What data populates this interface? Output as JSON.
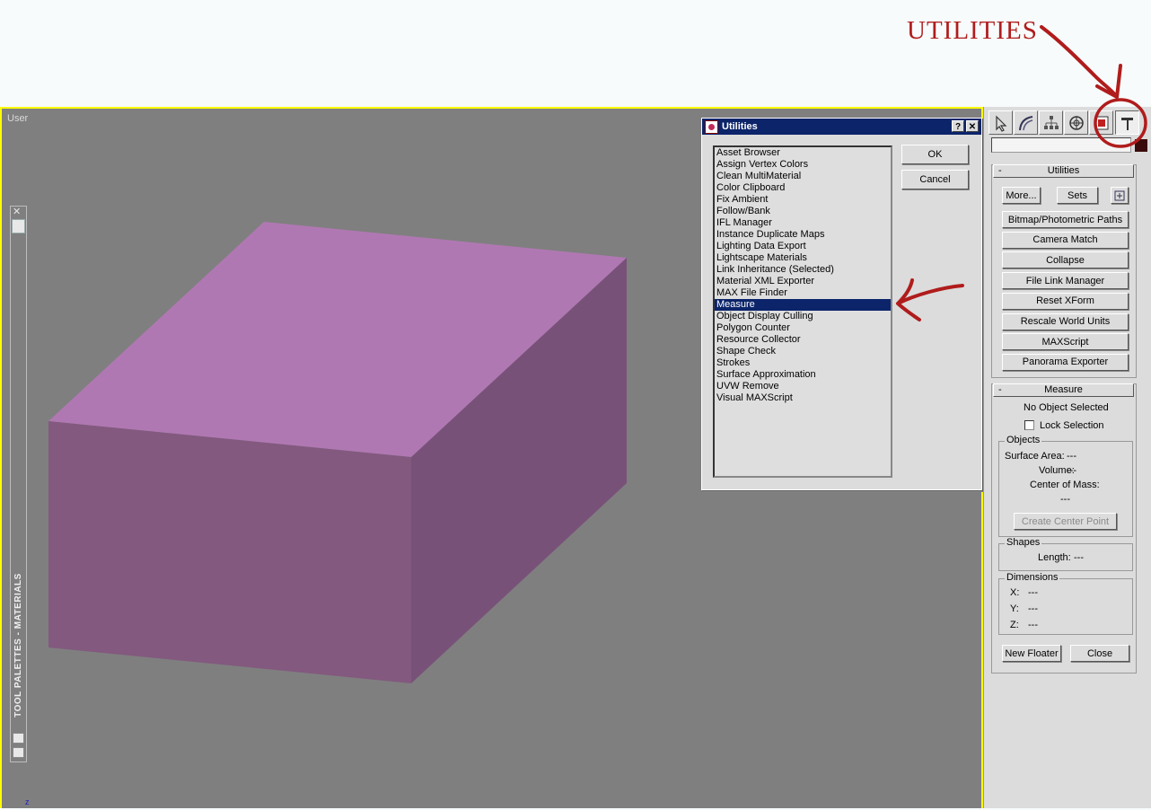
{
  "annotation": {
    "title": "UTILITIES"
  },
  "viewport": {
    "label": "User",
    "axis": "z"
  },
  "tool_palette": {
    "label": "TOOL PALETTES - MATERIALS",
    "close": "✕"
  },
  "dialog": {
    "title": "Utilities",
    "help": "?",
    "close": "✕",
    "items": [
      "Asset Browser",
      "Assign Vertex Colors",
      "Clean MultiMaterial",
      "Color Clipboard",
      "Fix Ambient",
      "Follow/Bank",
      "IFL Manager",
      "Instance Duplicate Maps",
      "Lighting Data Export",
      "Lightscape Materials",
      "Link Inheritance (Selected)",
      "Material XML Exporter",
      "MAX File Finder",
      "Measure",
      "Object Display Culling",
      "Polygon Counter",
      "Resource Collector",
      "Shape Check",
      "Strokes",
      "Surface Approximation",
      "UVW Remove",
      "Visual MAXScript"
    ],
    "selected": "Measure",
    "ok": "OK",
    "cancel": "Cancel"
  },
  "utilities": {
    "minus": "-",
    "title": "Utilities",
    "more": "More...",
    "sets": "Sets",
    "buttons": [
      "Bitmap/Photometric Paths",
      "Camera Match",
      "Collapse",
      "File Link Manager",
      "Reset XForm",
      "Rescale World Units",
      "MAXScript",
      "Panorama Exporter"
    ]
  },
  "measure": {
    "minus": "-",
    "title": "Measure",
    "status": "No Object Selected",
    "lock": "Lock Selection",
    "objects_label": "Objects",
    "surface_area": "Surface Area:",
    "surface_area_val": "---",
    "volume": "Volume:",
    "volume_val": "---",
    "center_of_mass": "Center of Mass:",
    "center_of_mass_val": "---",
    "create_center": "Create Center Point",
    "shapes_label": "Shapes",
    "length": "Length:",
    "length_val": "---",
    "dimensions_label": "Dimensions",
    "x": "X:",
    "x_val": "---",
    "y": "Y:",
    "y_val": "---",
    "z": "Z:",
    "z_val": "---",
    "new_floater": "New Floater",
    "close": "Close"
  },
  "colors": {
    "accent": "#0b246a",
    "annotation": "#b01c1c",
    "viewport_border": "#ffff00",
    "box_top": "#b078b3",
    "box_front": "#83597f",
    "box_side": "#785179"
  }
}
